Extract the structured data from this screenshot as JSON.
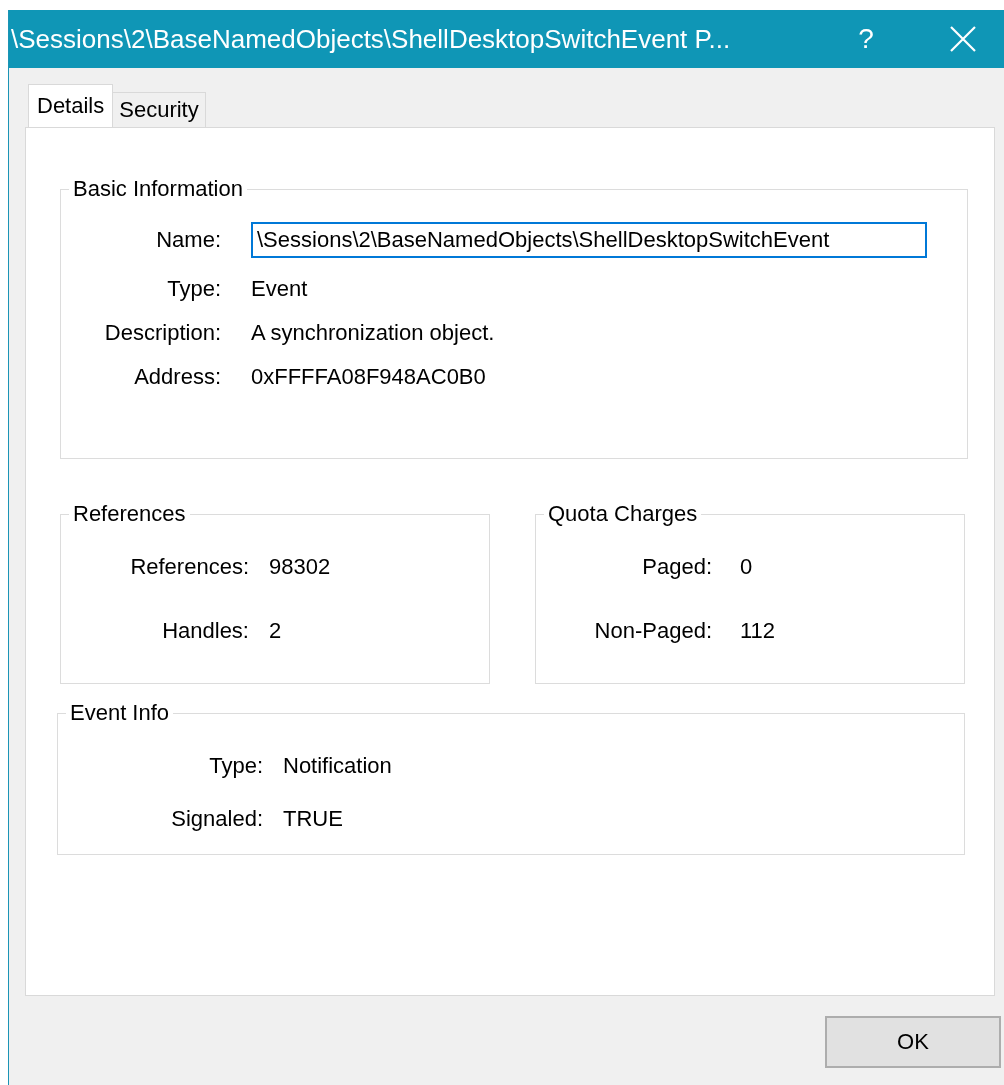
{
  "window": {
    "title": "\\Sessions\\2\\BaseNamedObjects\\ShellDesktopSwitchEvent P...",
    "help_button": "?"
  },
  "tabs": [
    {
      "label": "Details",
      "selected": true
    },
    {
      "label": "Security",
      "selected": false
    }
  ],
  "basic_information": {
    "title": "Basic Information",
    "fields": [
      {
        "label": "Name:",
        "value": "\\Sessions\\2\\BaseNamedObjects\\ShellDesktopSwitchEvent",
        "kind": "field"
      },
      {
        "label": "Type:",
        "value": "Event",
        "kind": "text"
      },
      {
        "label": "Description:",
        "value": "A synchronization object.",
        "kind": "text"
      },
      {
        "label": "Address:",
        "value": "0xFFFFA08F948AC0B0",
        "kind": "text"
      }
    ]
  },
  "references": {
    "title": "References",
    "fields": [
      {
        "label": "References:",
        "value": "98302",
        "kind": "text"
      },
      {
        "label": "Handles:",
        "value": "2",
        "kind": "text"
      }
    ]
  },
  "quota_charges": {
    "title": "Quota Charges",
    "fields": [
      {
        "label": "Paged:",
        "value": "0",
        "kind": "text"
      },
      {
        "label": "Non-Paged:",
        "value": "112",
        "kind": "text"
      }
    ]
  },
  "event_info": {
    "title": "Event Info",
    "fields": [
      {
        "label": "Type:",
        "value": "Notification",
        "kind": "text"
      },
      {
        "label": "Signaled:",
        "value": "TRUE",
        "kind": "text"
      }
    ]
  },
  "buttons": [
    "OK"
  ]
}
